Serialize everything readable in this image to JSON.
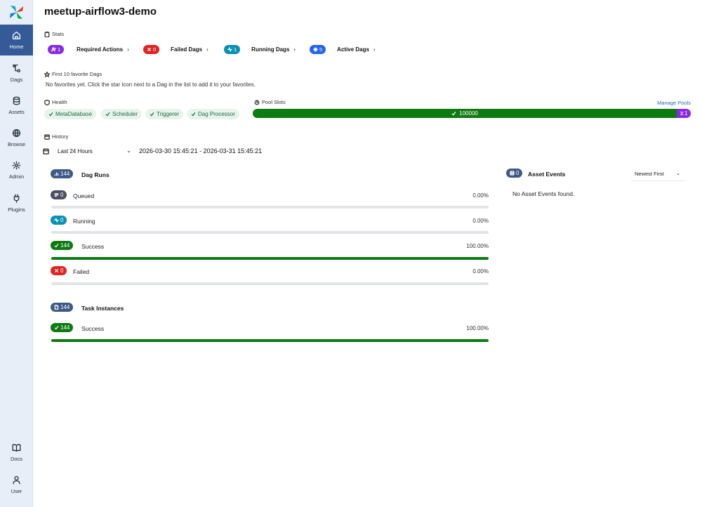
{
  "sidebar": {
    "items": [
      {
        "label": "Home",
        "icon": "home-icon"
      },
      {
        "label": "Dags",
        "icon": "dags-icon"
      },
      {
        "label": "Assets",
        "icon": "database-icon"
      },
      {
        "label": "Browse",
        "icon": "globe-icon"
      },
      {
        "label": "Admin",
        "icon": "gear-icon"
      },
      {
        "label": "Plugins",
        "icon": "plug-icon"
      }
    ],
    "bottom": [
      {
        "label": "Docs",
        "icon": "book-icon"
      },
      {
        "label": "User",
        "icon": "user-icon"
      }
    ],
    "active_color": "#345b97"
  },
  "header": {
    "title": "meetup-airflow3-demo"
  },
  "stats": {
    "label": "Stats",
    "items": [
      {
        "count": "1",
        "label": "Required Actions",
        "color": "#8a2be2"
      },
      {
        "count": "0",
        "label": "Failed Dags",
        "color": "#e02424"
      },
      {
        "count": "1",
        "label": "Running Dags",
        "color": "#0891b2"
      },
      {
        "count": "5",
        "label": "Active Dags",
        "color": "#2563eb"
      }
    ]
  },
  "favorites": {
    "label": "First 10 favorite Dags",
    "empty_text": "No favorites yet. Click the star icon next to a Dag in the list to add it to your favorites."
  },
  "health": {
    "label": "Health",
    "items": [
      "MetaDatabase",
      "Scheduler",
      "Triggerer",
      "Dag Processor"
    ]
  },
  "pool": {
    "label": "Pool Slots",
    "manage_label": "Manage Pools",
    "open_slots": "100000",
    "other_slots": "1"
  },
  "history": {
    "label": "History",
    "range_option": "Last 24 Hours",
    "date_range": "2026-03-30 15:45:21 - 2026-03-31 15:45:21",
    "dag_runs": {
      "title": "Dag Runs",
      "total": "144",
      "rows": [
        {
          "label": "Queued",
          "count": "0",
          "pct": "0.00%",
          "fraction": 0.0,
          "color": "#4a5060"
        },
        {
          "label": "Running",
          "count": "0",
          "pct": "0.00%",
          "fraction": 0.0,
          "color": "#0891b2"
        },
        {
          "label": "Success",
          "count": "144",
          "pct": "100.00%",
          "fraction": 1.0,
          "color": "#0e7a12"
        },
        {
          "label": "Failed",
          "count": "0",
          "pct": "0.00%",
          "fraction": 0.0,
          "color": "#e02424"
        }
      ]
    },
    "task_instances": {
      "title": "Task Instances",
      "total": "144",
      "rows": [
        {
          "label": "Success",
          "count": "144",
          "pct": "100.00%",
          "fraction": 1.0,
          "color": "#0e7a12"
        }
      ]
    }
  },
  "assets": {
    "title": "Asset Events",
    "count": "0",
    "sort": "Newest First",
    "empty_text": "No Asset Events found."
  }
}
